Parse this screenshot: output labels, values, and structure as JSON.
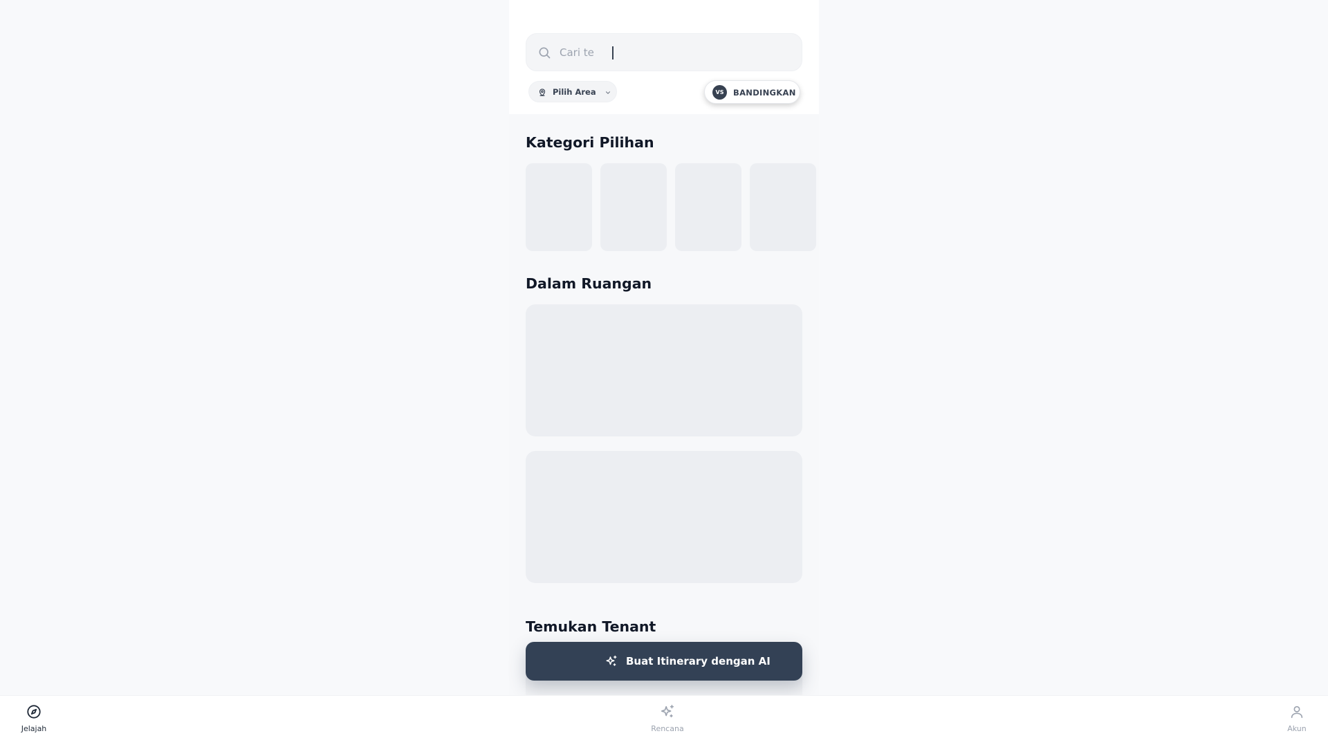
{
  "search": {
    "typed_value": "Cari te",
    "icon": "search-icon"
  },
  "filters": {
    "area_label": "Pilih Area",
    "area_icon": "map-pin-icon",
    "compare_badge": "VS",
    "compare_label": "BANDINGKAN"
  },
  "sections": {
    "categories_title": "Kategori Pilihan",
    "indoor_title": "Dalam Ruangan",
    "tenants_title": "Temukan Tenant"
  },
  "ai_button": {
    "label": "Buat Itinerary dengan AI",
    "icon": "sparkles-icon"
  },
  "bottom_nav": {
    "items": [
      {
        "label": "Jelajah",
        "icon": "compass-icon",
        "active": true
      },
      {
        "label": "Rencana",
        "icon": "sparkles-icon",
        "active": false
      },
      {
        "label": "Akun",
        "icon": "user-icon",
        "active": false
      }
    ]
  },
  "colors": {
    "primary": "#334155",
    "background": "#f8f9fb",
    "skeleton": "#eceef2",
    "muted_text": "#9ca3af"
  }
}
